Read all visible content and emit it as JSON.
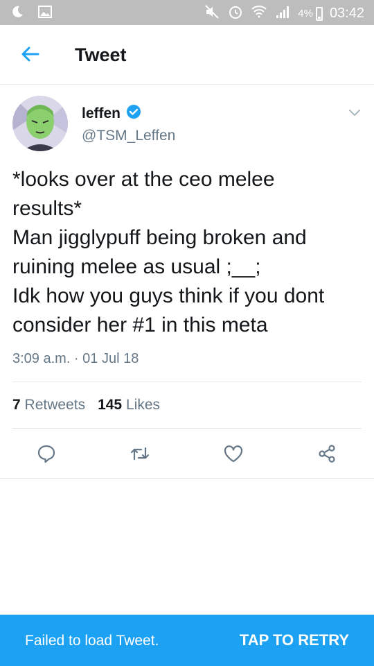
{
  "status_bar": {
    "icons": [
      "moon-icon",
      "image-icon",
      "mute-icon",
      "alarm-icon",
      "wifi-icon",
      "signal-icon"
    ],
    "battery": "4%",
    "time": "03:42"
  },
  "app_bar": {
    "back_icon": "arrow-left-icon",
    "title": "Tweet"
  },
  "tweet": {
    "author": {
      "name": "leffen",
      "verified": true,
      "handle": "@TSM_Leffen"
    },
    "text_lines": [
      "*looks over at the ceo melee",
      "results*",
      "Man jigglypuff being broken and",
      "ruining melee as usual ;__;",
      "Idk how you guys think if you dont",
      "consider her #1 in this meta"
    ],
    "timestamp": "3:09 a.m. · 01 Jul 18",
    "retweets": {
      "count": "7",
      "label": "Retweets"
    },
    "likes": {
      "count": "145",
      "label": "Likes"
    },
    "actions": [
      "reply-icon",
      "retweet-icon",
      "like-icon",
      "share-icon"
    ]
  },
  "snackbar": {
    "message": "Failed to load Tweet.",
    "action": "TAP TO RETRY"
  },
  "colors": {
    "accent": "#1da1f2",
    "status_bar": "#bdbdbd",
    "secondary_text": "#657786",
    "divider": "#e1e8ed"
  }
}
